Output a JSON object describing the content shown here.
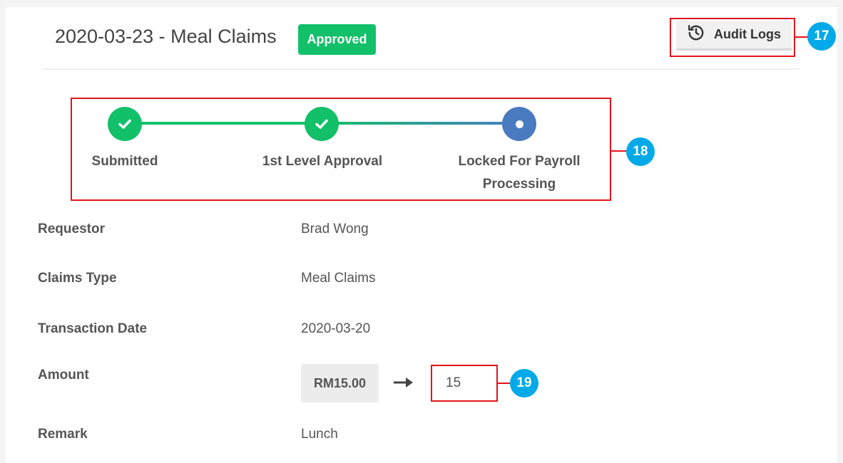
{
  "header": {
    "title": "2020-03-23 - Meal Claims",
    "status": "Approved",
    "audit_logs_label": "Audit Logs"
  },
  "annotations": [
    "17",
    "18",
    "19"
  ],
  "progress": {
    "steps": [
      {
        "label": "Submitted",
        "state": "completed"
      },
      {
        "label": "1st Level Approval",
        "state": "completed"
      },
      {
        "label_line1": "Locked For Payroll",
        "label_line2": "Processing",
        "state": "current"
      }
    ]
  },
  "details": {
    "fields": [
      {
        "label": "Requestor",
        "value": "Brad Wong"
      },
      {
        "label": "Claims Type",
        "value": "Meal Claims"
      },
      {
        "label": "Transaction Date",
        "value": "2020-03-20"
      },
      {
        "label": "Amount",
        "original": "RM15.00",
        "edited": "15"
      },
      {
        "label": "Remark",
        "value": "Lunch"
      }
    ]
  },
  "colors": {
    "approved_green": "#12c06a",
    "current_blue": "#4a7bc0",
    "callout_red": "#e3141b",
    "marker_blue": "#00a9e8"
  },
  "icons": {
    "audit": "history-icon",
    "completed": "check-icon",
    "amount_change": "arrow-right-icon"
  }
}
